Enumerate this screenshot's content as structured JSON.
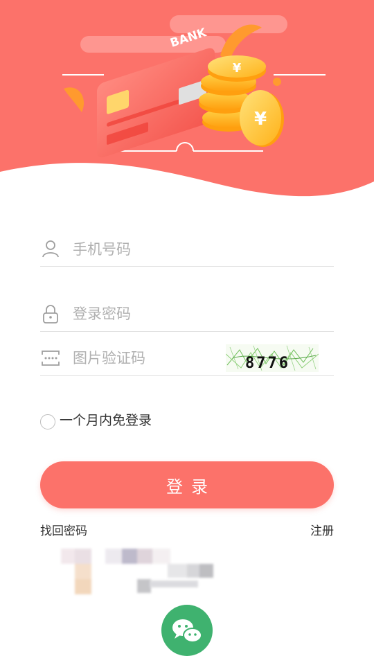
{
  "hero": {
    "card_brand": "BANK",
    "coin_symbol": "¥"
  },
  "form": {
    "phone_placeholder": "手机号码",
    "password_placeholder": "登录密码",
    "captcha_placeholder": "图片验证码",
    "captcha_text": "8776"
  },
  "remember": {
    "label": "一个月内免登录",
    "checked": false
  },
  "login_button": {
    "label": "登录"
  },
  "links": {
    "forgot_password": "找回密码",
    "register": "注册"
  },
  "colors": {
    "brand": "#fc726a",
    "hero_bg": "#fc726a",
    "wechat": "#3fb26f"
  },
  "icons": {
    "phone_field": "user-icon",
    "password_field": "lock-icon",
    "captcha_field": "captcha-icon",
    "social_login": "wechat-icon"
  }
}
